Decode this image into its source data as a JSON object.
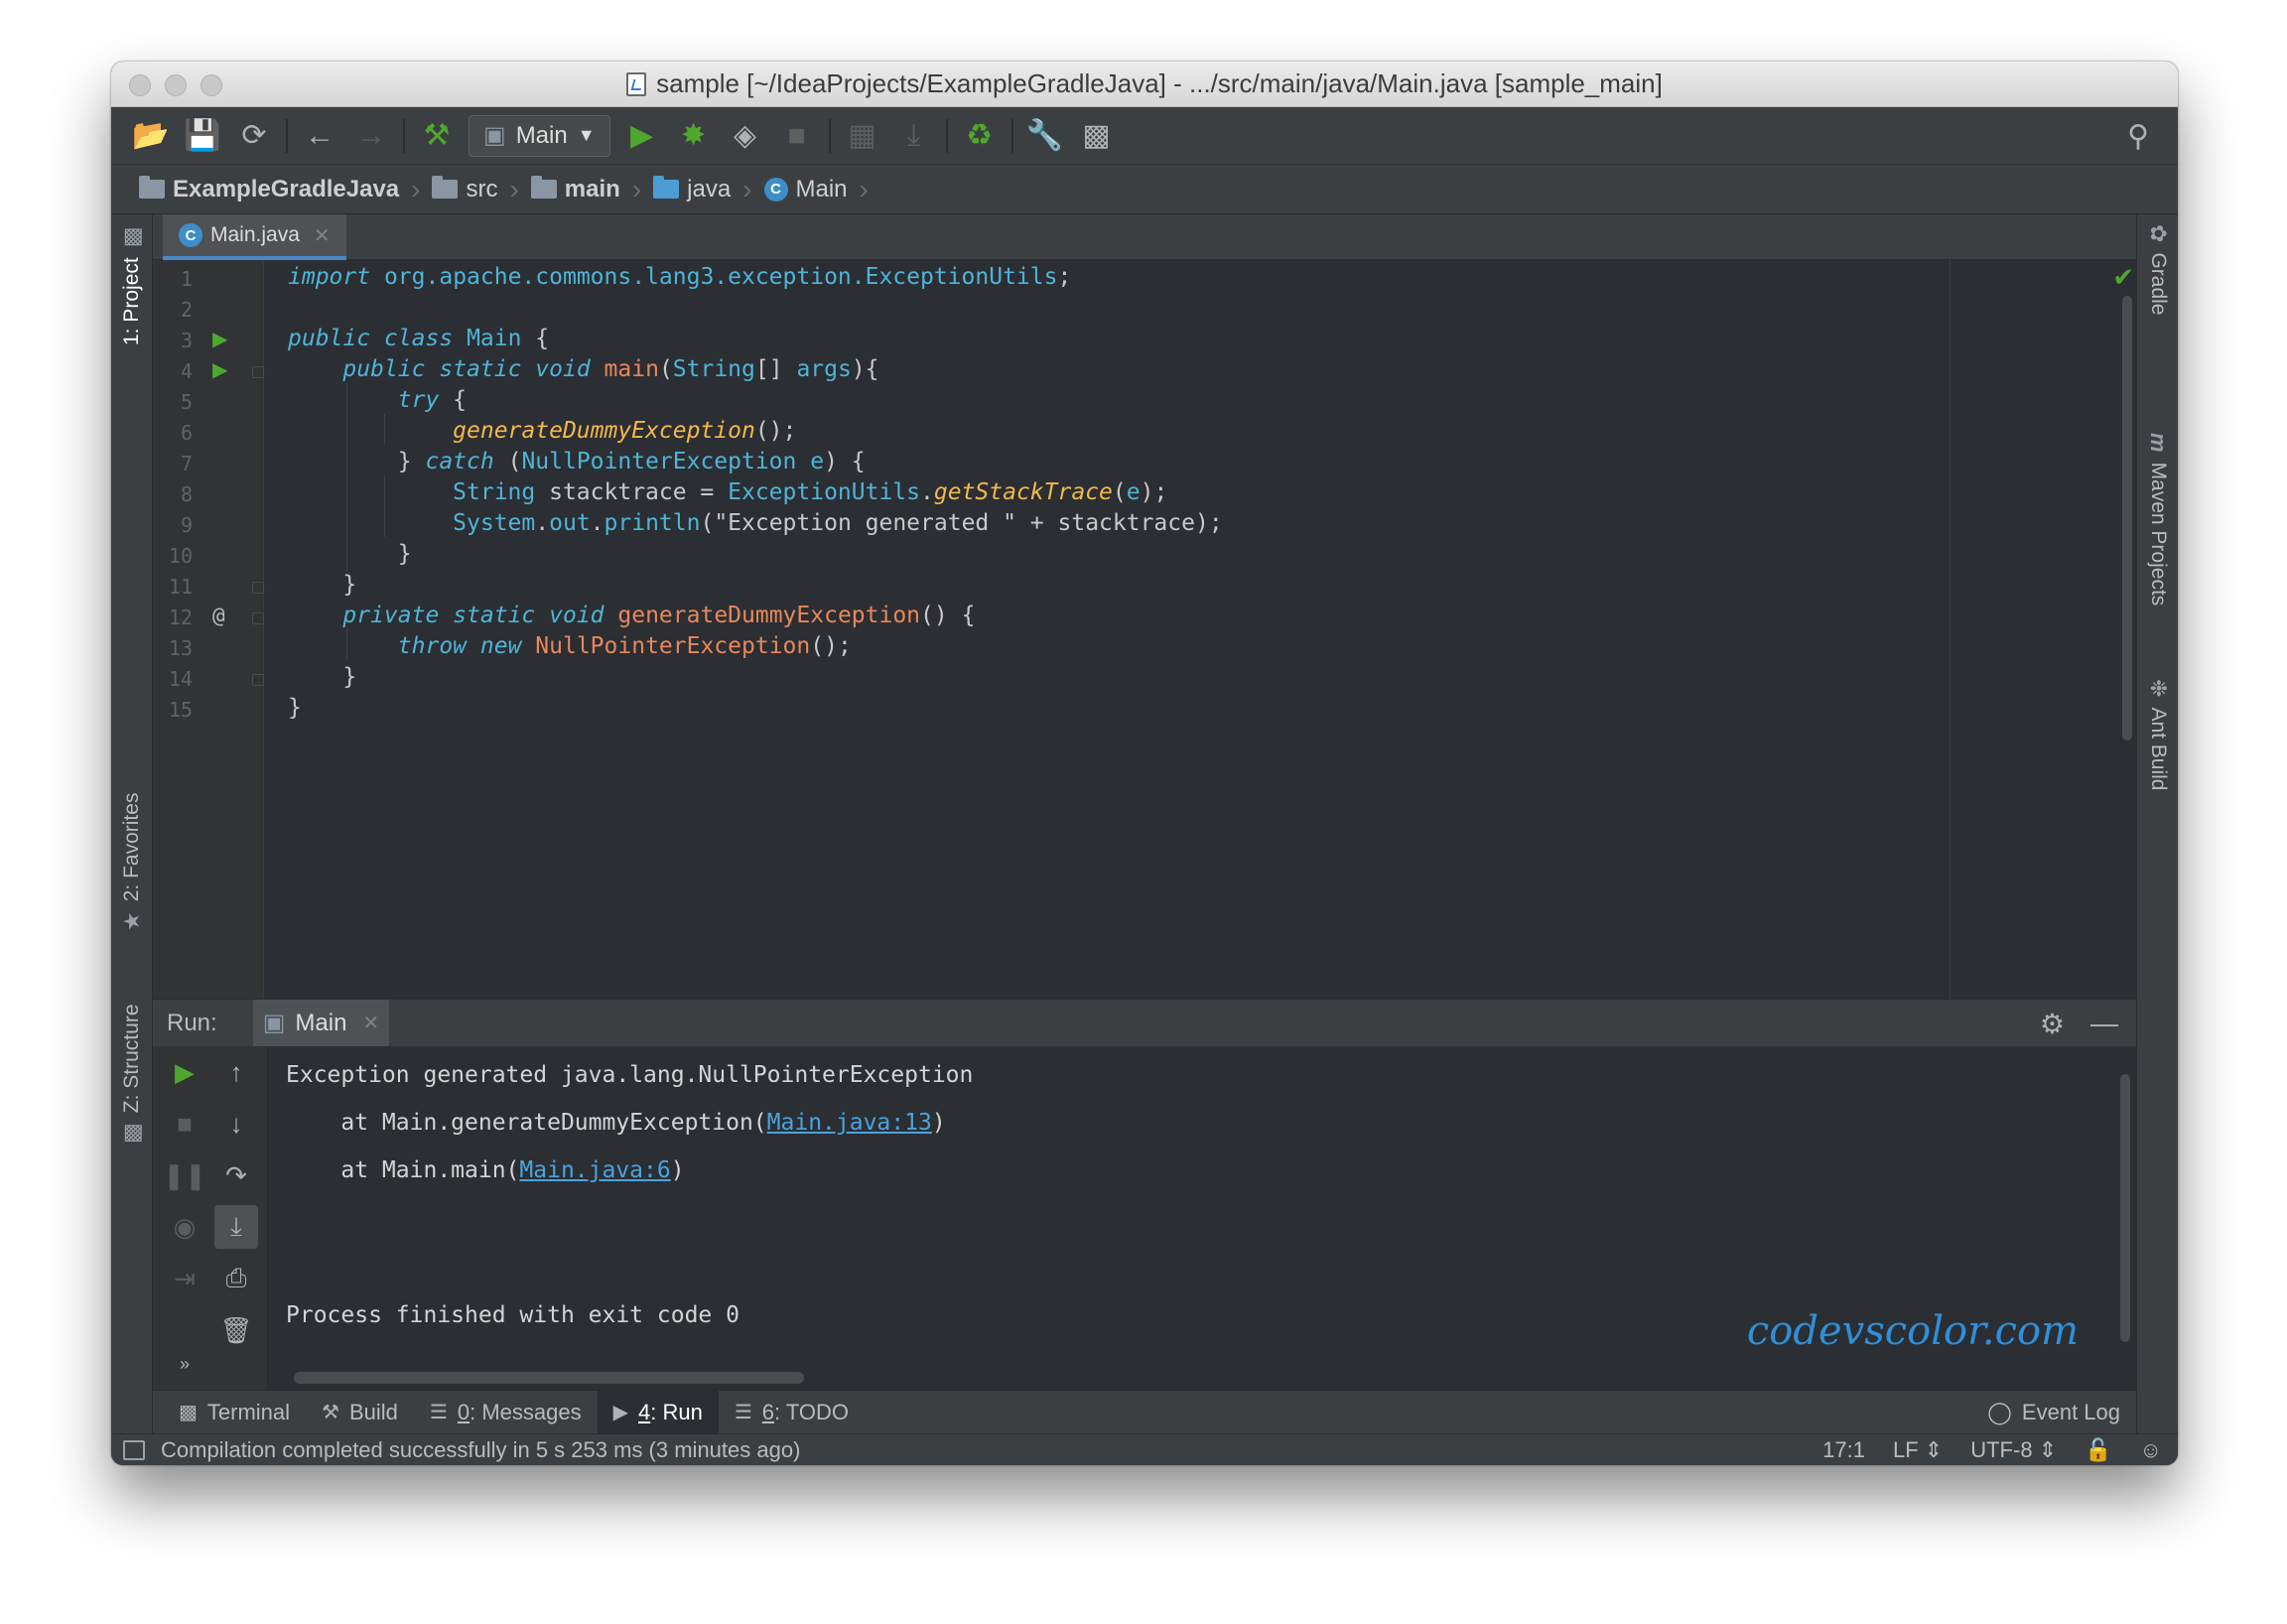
{
  "window": {
    "title": "sample [~/IdeaProjects/ExampleGradleJava] - .../src/main/java/Main.java [sample_main]"
  },
  "toolbar": {
    "run_config": "Main"
  },
  "breadcrumb": [
    "ExampleGradleJava",
    "src",
    "main",
    "java",
    "Main"
  ],
  "left_tabs": {
    "project": "1: Project",
    "favorites": "2: Favorites",
    "structure": "Z: Structure"
  },
  "right_tabs": {
    "gradle": "Gradle",
    "maven_icon": "m",
    "maven": "Maven Projects",
    "ant": "Ant Build"
  },
  "editor": {
    "tab_label": "Main.java",
    "line_numbers": [
      "1",
      "2",
      "3",
      "4",
      "5",
      "6",
      "7",
      "8",
      "9",
      "10",
      "11",
      "12",
      "13",
      "14",
      "15"
    ]
  },
  "run_panel": {
    "label": "Run:",
    "tab": "Main",
    "console": {
      "l1": "Exception generated java.lang.NullPointerException",
      "l2_pre": "    at Main.generateDummyException(",
      "l2_link": "Main.java:13",
      "l3_pre": "    at Main.main(",
      "l3_link": "Main.java:6",
      "close": ")",
      "finish": "Process finished with exit code 0"
    },
    "watermark": "codevscolor.com"
  },
  "tool_tabs": {
    "terminal": "Terminal",
    "build": "Build",
    "messages_num": "0",
    "messages": ": Messages",
    "run_num": "4",
    "run": ": Run",
    "todo_num": "6",
    "todo": ": TODO",
    "event_log": "Event Log"
  },
  "status": {
    "message": "Compilation completed successfully in 5 s 253 ms (3 minutes ago)",
    "position": "17:1",
    "line_sep": "LF",
    "encoding": "UTF-8"
  },
  "colors": {
    "keyword": "#4fb4d8",
    "method": "#e8875a",
    "static_call": "#f2b84b",
    "link": "#4aa3df",
    "run_green": "#4ea72e",
    "watermark": "#2f8fd8"
  }
}
